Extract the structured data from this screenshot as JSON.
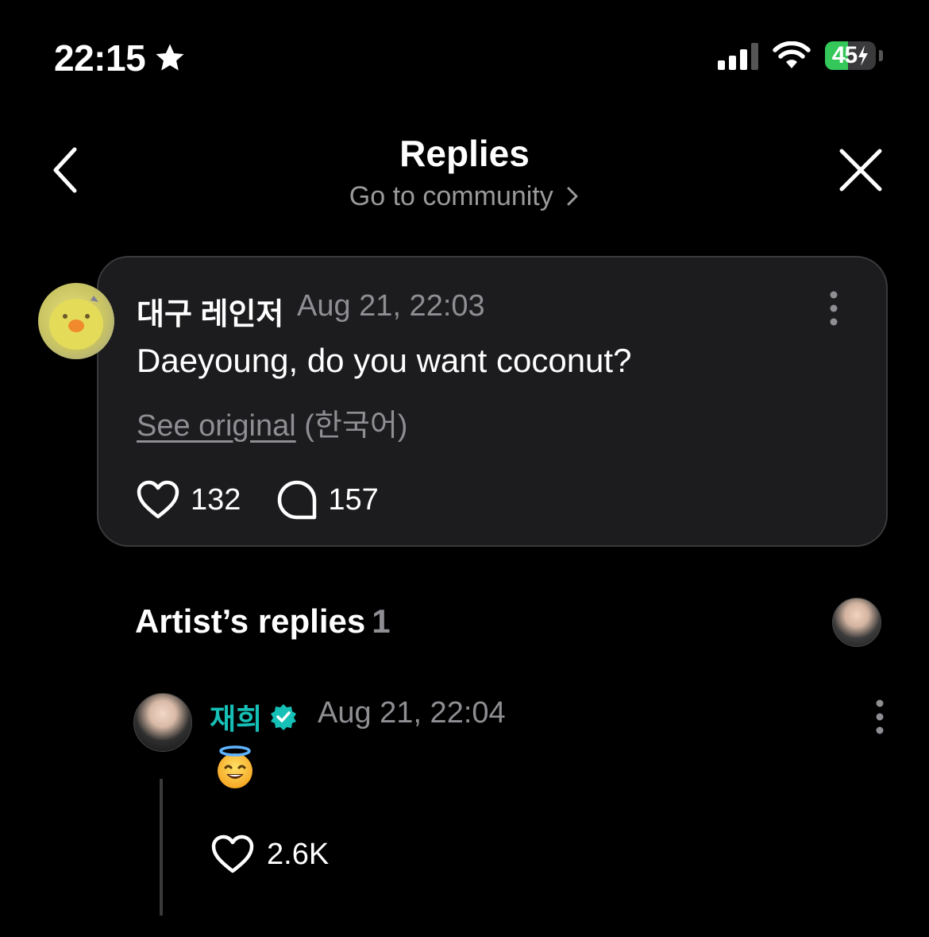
{
  "status_bar": {
    "time": "22:15",
    "battery_percent": "45",
    "battery_level": 0.45,
    "icons": [
      "star-icon",
      "signal-icon",
      "wifi-icon",
      "battery-charging-icon"
    ]
  },
  "header": {
    "title": "Replies",
    "subtitle": "Go to community",
    "back_icon": "chevron-left-icon",
    "close_icon": "close-icon"
  },
  "post": {
    "author": "대구 레인저",
    "date": "Aug 21, 22:03",
    "text": "Daeyoung, do you want coconut?",
    "see_original_label": "See original",
    "original_language": "(한국어)",
    "likes": "132",
    "comments": "157"
  },
  "artist_replies": {
    "title": "Artist’s replies",
    "count": "1",
    "replies": [
      {
        "name": "재희",
        "verified": true,
        "date": "Aug 21, 22:04",
        "content_emoji": "smiling-face-with-halo",
        "likes": "2.6K"
      }
    ]
  },
  "colors": {
    "background": "#000000",
    "card": "#1c1c1e",
    "muted_text": "#8e8e93",
    "artist_accent": "#16c0b6",
    "battery_green": "#34c759"
  }
}
